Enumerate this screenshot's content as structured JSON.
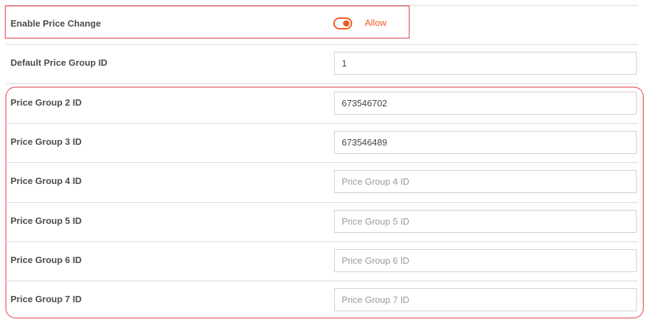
{
  "enable_price_change": {
    "label": "Enable Price Change",
    "toggle_on": true,
    "toggle_label": "Allow",
    "accent_color": "#f15a22"
  },
  "default_price_group": {
    "label": "Default Price Group ID",
    "value": "1"
  },
  "price_groups": [
    {
      "label": "Price Group 2 ID",
      "value": "673546702",
      "placeholder": "Price Group 2 ID"
    },
    {
      "label": "Price Group 3 ID",
      "value": "673546489",
      "placeholder": "Price Group 3 ID"
    },
    {
      "label": "Price Group 4 ID",
      "value": "",
      "placeholder": "Price Group 4 ID"
    },
    {
      "label": "Price Group 5 ID",
      "value": "",
      "placeholder": "Price Group 5 ID"
    },
    {
      "label": "Price Group 6 ID",
      "value": "",
      "placeholder": "Price Group 6 ID"
    },
    {
      "label": "Price Group 7 ID",
      "value": "",
      "placeholder": "Price Group 7 ID"
    }
  ],
  "highlight_color": "#e0393e"
}
